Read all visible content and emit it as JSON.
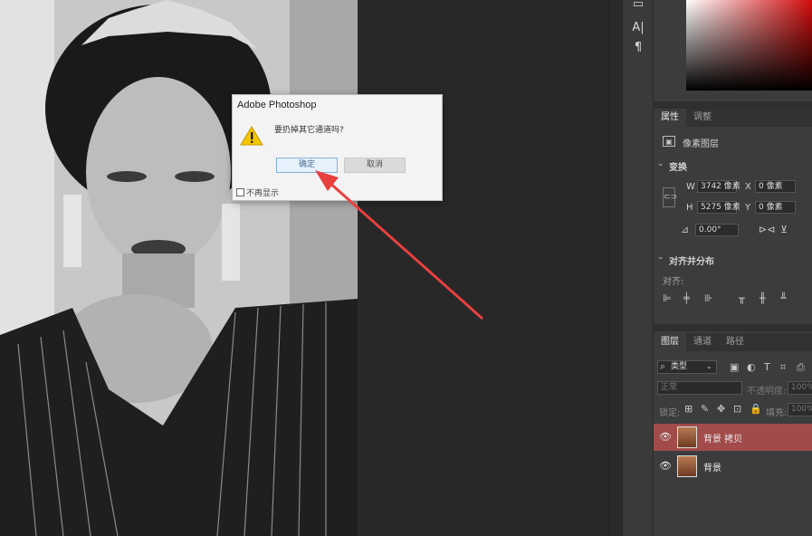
{
  "dialog": {
    "title": "Adobe Photoshop",
    "message": "要扔掉其它通道吗?",
    "ok_label": "确定",
    "cancel_label": "取消",
    "checkbox_label": "不再显示"
  },
  "tools": {
    "char_icon": "A|",
    "para_icon": "¶"
  },
  "properties": {
    "tabs": [
      "属性",
      "调整"
    ],
    "layer_type": "像素图层",
    "transform_header": "变换",
    "w_label": "W",
    "w_value": "3742 像素",
    "h_label": "H",
    "h_value": "5275 像素",
    "x_label": "X",
    "x_value": "0 像素",
    "y_label": "Y",
    "y_value": "0 像素",
    "angle_value": "0.00°",
    "align_header": "对齐并分布",
    "align_label": "对齐:"
  },
  "layers_panel": {
    "tabs": [
      "图层",
      "通道",
      "路径"
    ],
    "filter_kind": "类型",
    "blend_mode": "正常",
    "opacity_label": "不透明度:",
    "opacity_value": "100%",
    "lock_label": "锁定:",
    "fill_label": "填充:",
    "fill_value": "100%",
    "layers": [
      {
        "name": "背景 拷贝",
        "selected": true
      },
      {
        "name": "背景",
        "selected": false
      }
    ]
  },
  "colors": {
    "accent_selected_layer": "#a14b4b",
    "annotation_arrow": "#e8403f"
  }
}
